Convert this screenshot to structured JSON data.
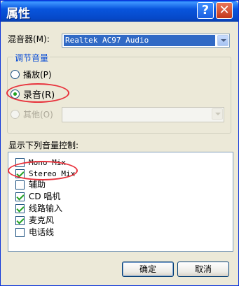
{
  "window": {
    "title": "属性"
  },
  "title_buttons": {
    "help_glyph": "?",
    "close_glyph": "✕"
  },
  "mixer": {
    "label": "混音器(M):",
    "selected": "Realtek AC97 Audio"
  },
  "adjust_group": {
    "title": "调节音量",
    "playback_label": "播放(P)",
    "record_label": "录音(R)",
    "other_label": "其他(O)",
    "selected": "record"
  },
  "controls": {
    "label": "显示下列音量控制:",
    "items": [
      {
        "label": "Mono Mix",
        "checked": false
      },
      {
        "label": "Stereo Mix",
        "checked": true
      },
      {
        "label": "辅助",
        "checked": false
      },
      {
        "label": "CD 唱机",
        "checked": true
      },
      {
        "label": "线路输入",
        "checked": true
      },
      {
        "label": "麦克风",
        "checked": true
      },
      {
        "label": "电话线",
        "checked": false
      }
    ]
  },
  "buttons": {
    "ok": "确定",
    "cancel": "取消"
  },
  "colors": {
    "title_blue": "#0855DD",
    "annotation_red": "#E8323C",
    "check_green": "#21A121"
  }
}
